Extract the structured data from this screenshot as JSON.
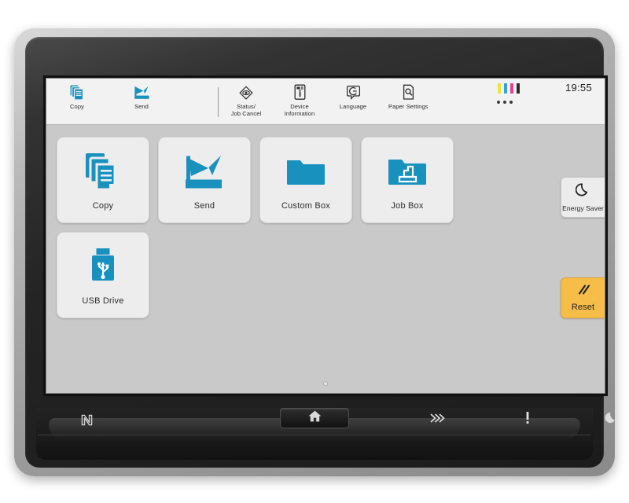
{
  "device": {
    "name": "multifunction-printer-touch-panel"
  },
  "screen": {
    "topbar": {
      "shortcuts": [
        {
          "label": "Copy",
          "icon": "copy-icon"
        },
        {
          "label": "Send",
          "icon": "send-icon"
        }
      ],
      "functions": [
        {
          "label": "Status/\nJob Cancel",
          "icon": "status-job-cancel-icon"
        },
        {
          "label": "Device\nInformation",
          "icon": "device-information-icon"
        },
        {
          "label": "Language",
          "icon": "language-icon"
        },
        {
          "label": "Paper Settings",
          "icon": "paper-settings-icon"
        }
      ],
      "more_label": "…",
      "clock": "19:55",
      "toner": [
        {
          "name": "yellow",
          "color": "#f2e03c"
        },
        {
          "name": "cyan",
          "color": "#2aa8d8"
        },
        {
          "name": "magenta",
          "color": "#ec3f8e"
        },
        {
          "name": "black",
          "color": "#2b2b2b"
        }
      ]
    },
    "tiles": [
      {
        "label": "Copy",
        "icon": "copy-icon"
      },
      {
        "label": "Send",
        "icon": "send-icon"
      },
      {
        "label": "Custom Box",
        "icon": "folder-icon"
      },
      {
        "label": "Job Box",
        "icon": "job-box-folder-icon"
      },
      {
        "label": "USB Drive",
        "icon": "usb-drive-icon"
      }
    ],
    "page_indicator": {
      "pages": 1,
      "current": 1
    }
  },
  "hardkeys": {
    "energy_saver": {
      "label": "Energy Saver",
      "icon": "moon-icon",
      "color": "#ececec"
    },
    "reset": {
      "label": "Reset",
      "icon": "double-slash-icon",
      "color": "#f6bd48"
    },
    "home": {
      "label": "Home",
      "icon": "home-icon"
    }
  },
  "indicators": {
    "nfc": {
      "label": "NFC",
      "icon": "nfc-icon"
    },
    "leds": [
      {
        "name": "data-indicator",
        "icon": "chevrons-right-icon"
      },
      {
        "name": "attention-indicator",
        "icon": "exclamation-icon"
      },
      {
        "name": "energy-saver-indicator",
        "icon": "moon-icon"
      }
    ]
  },
  "colors": {
    "accent_blue": "#1991bf",
    "reset_amber": "#f6bd48",
    "screen_bg": "#c9c9c9",
    "topbar_bg": "#f2f2f2"
  }
}
